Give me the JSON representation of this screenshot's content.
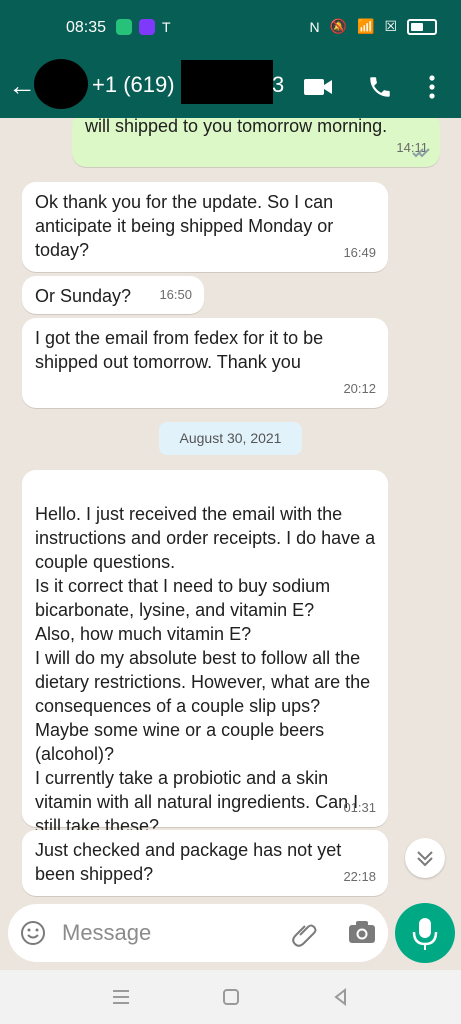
{
  "status": {
    "time": "08:35",
    "right_label": "N"
  },
  "header": {
    "contact_prefix": "+1 (619)",
    "contact_suffix": "3"
  },
  "messages": [
    {
      "text": "will shipped to you tomorrow morning.",
      "time": "14:11",
      "direction": "out"
    },
    {
      "text": "Ok thank you for the update. So I can anticipate it being shipped Monday or today?",
      "time": "16:49",
      "direction": "in"
    },
    {
      "text": "Or Sunday?",
      "time": "16:50",
      "direction": "in"
    },
    {
      "text": "I got the email from fedex for it to be shipped out tomorrow. Thank you",
      "time": "20:12",
      "direction": "in"
    },
    {
      "text": "Hello. I just received the email with the instructions and order receipts. I do have a couple questions.\nIs it correct that I need to buy sodium bicarbonate, lysine, and vitamin E?\nAlso, how much vitamin E?\nI will do my absolute best to follow all the dietary restrictions. However, what are the consequences of a couple slip ups? Maybe some wine or a couple beers (alcohol)?\nI currently take a probiotic and a skin vitamin with all natural ingredients. Can I still take these?",
      "time": "01:31",
      "direction": "in"
    },
    {
      "text": "Just checked and package has not yet been shipped?",
      "time": "22:18",
      "direction": "in"
    }
  ],
  "date_divider": "August 30, 2021",
  "composer": {
    "placeholder": "Message"
  },
  "icons": {
    "back": "arrow-left",
    "video": "video-camera",
    "call": "phone",
    "more": "more-vertical",
    "emoji": "emoji",
    "attach": "paperclip",
    "camera": "camera",
    "mic": "microphone",
    "scroll_down": "double-chevron-down"
  },
  "colors": {
    "appbar": "#075e54",
    "chat_bg": "#ece5dd",
    "outgoing_bubble": "#dcf8c6",
    "incoming_bubble": "#ffffff",
    "accent": "#00a884"
  }
}
